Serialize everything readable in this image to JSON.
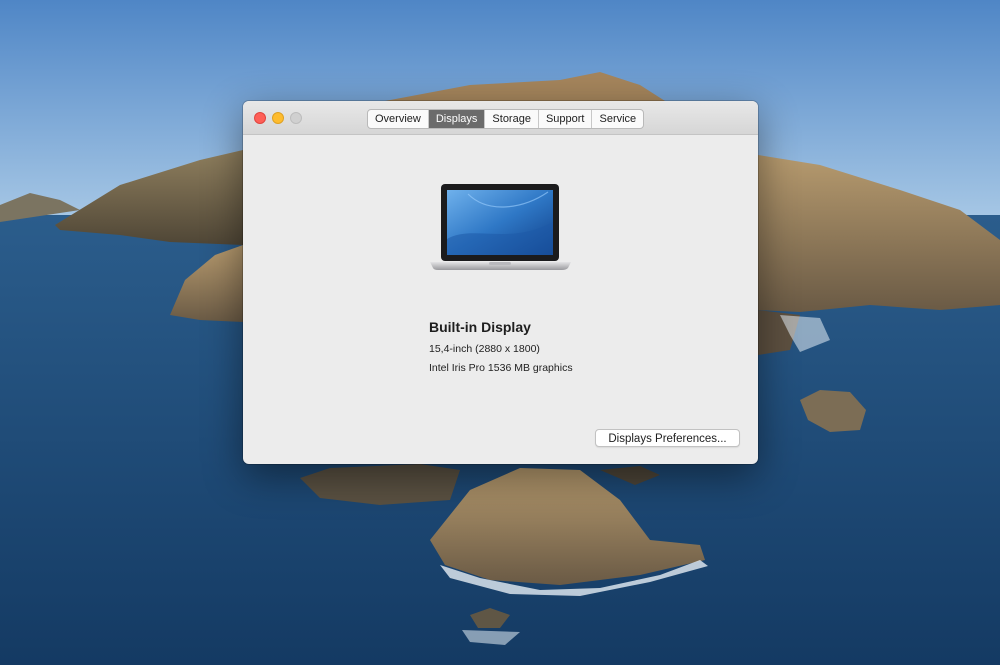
{
  "window": {
    "tabs": [
      {
        "label": "Overview",
        "active": false
      },
      {
        "label": "Displays",
        "active": true
      },
      {
        "label": "Storage",
        "active": false
      },
      {
        "label": "Support",
        "active": false
      },
      {
        "label": "Service",
        "active": false
      }
    ]
  },
  "display": {
    "name": "Built-in Display",
    "size": "15,4-inch (2880 x 1800)",
    "graphics": "Intel Iris Pro 1536 MB graphics",
    "icon": "macbook-pro-icon"
  },
  "buttons": {
    "preferences_label": "Displays Preferences..."
  },
  "colors": {
    "close": "#fe5f57",
    "minimize": "#febc2e",
    "zoom_disabled": "#d0d0d0",
    "active_tab": "#6b6b6b",
    "window_bg": "#ececec"
  }
}
